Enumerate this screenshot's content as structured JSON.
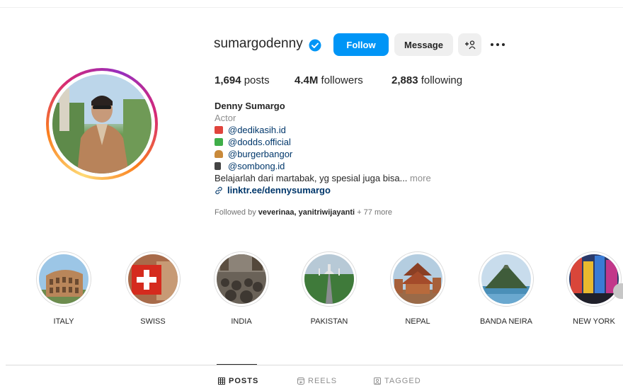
{
  "profile": {
    "username": "sumargodenny",
    "verified": true,
    "full_name": "Denny Sumargo",
    "category": "Actor"
  },
  "actions": {
    "follow_label": "Follow",
    "message_label": "Message",
    "add_user_label": "+ዖ",
    "more_label": "more options"
  },
  "stats": {
    "posts_count": "1,694",
    "posts_label": "posts",
    "followers_count": "4.4M",
    "followers_label": "followers",
    "following_count": "2,883",
    "following_label": "following"
  },
  "bio": {
    "mentions": [
      {
        "icon": "house-emoji-icon",
        "text": "@dedikasih.id",
        "color": "#e0443c"
      },
      {
        "icon": "shirt-emoji-icon",
        "text": "@dodds.official",
        "color": "#3fae49"
      },
      {
        "icon": "burger-emoji-icon",
        "text": "@burgerbangor",
        "color": "#c98a3b"
      },
      {
        "icon": "person-emoji-icon",
        "text": "@sombong.id",
        "color": "#444444"
      }
    ],
    "text": "Belajarlah dari martabak, yg spesial juga bisa...",
    "more": " more",
    "link": "linktr.ee/dennysumargo"
  },
  "followed_by": {
    "prefix": "Followed by ",
    "users": "veverinaa, yanitriwijayanti",
    "suffix": " + 77 more"
  },
  "highlights": [
    {
      "label": "ITALY",
      "icon": "colosseum-icon"
    },
    {
      "label": "SWISS",
      "icon": "swiss-flag-icon"
    },
    {
      "label": "INDIA",
      "icon": "street-scene-icon"
    },
    {
      "label": "PAKISTAN",
      "icon": "mosque-road-icon"
    },
    {
      "label": "NEPAL",
      "icon": "temple-icon"
    },
    {
      "label": "BANDA NEIRA",
      "icon": "volcano-icon"
    },
    {
      "label": "NEW YORK",
      "icon": "times-square-icon"
    }
  ],
  "tabs": [
    {
      "label": "POSTS",
      "icon": "grid-icon",
      "active": true
    },
    {
      "label": "REELS",
      "icon": "reels-icon",
      "active": false
    },
    {
      "label": "TAGGED",
      "icon": "tagged-icon",
      "active": false
    }
  ],
  "colors": {
    "accent": "#0095f6",
    "link": "#00376b",
    "muted": "#8e8e8e",
    "verified": "#0095f6"
  }
}
